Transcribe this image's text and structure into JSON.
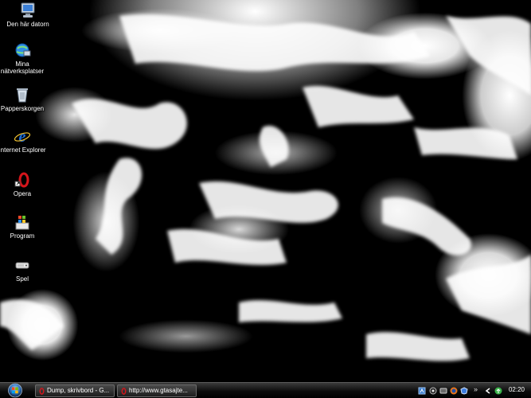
{
  "desktop": {
    "icons": [
      {
        "label": "Den här datorn",
        "icon": "computer-icon"
      },
      {
        "label": "Mina nätverksplatser",
        "icon": "network-places-icon"
      },
      {
        "label": "Papperskorgen",
        "icon": "recycle-bin-icon"
      },
      {
        "label": "Internet Explorer",
        "icon": "internet-explorer-icon"
      },
      {
        "label": "Opera",
        "icon": "opera-icon"
      },
      {
        "label": "Program",
        "icon": "program-icon"
      },
      {
        "label": "Spel",
        "icon": "games-icon"
      }
    ]
  },
  "taskbar": {
    "start": "start-orb-icon",
    "tasks": [
      {
        "label": "Dump, skrivbord - G...",
        "icon": "opera-icon"
      },
      {
        "label": "http://www.gtasajte...",
        "icon": "opera-icon"
      }
    ],
    "tray": {
      "chevron": "»",
      "clock": "02:20"
    }
  },
  "colors": {
    "taskbar": "#0c0c0c",
    "text": "#ffffff",
    "opera": "#d4151b",
    "ie_blue": "#1e6fd8"
  }
}
